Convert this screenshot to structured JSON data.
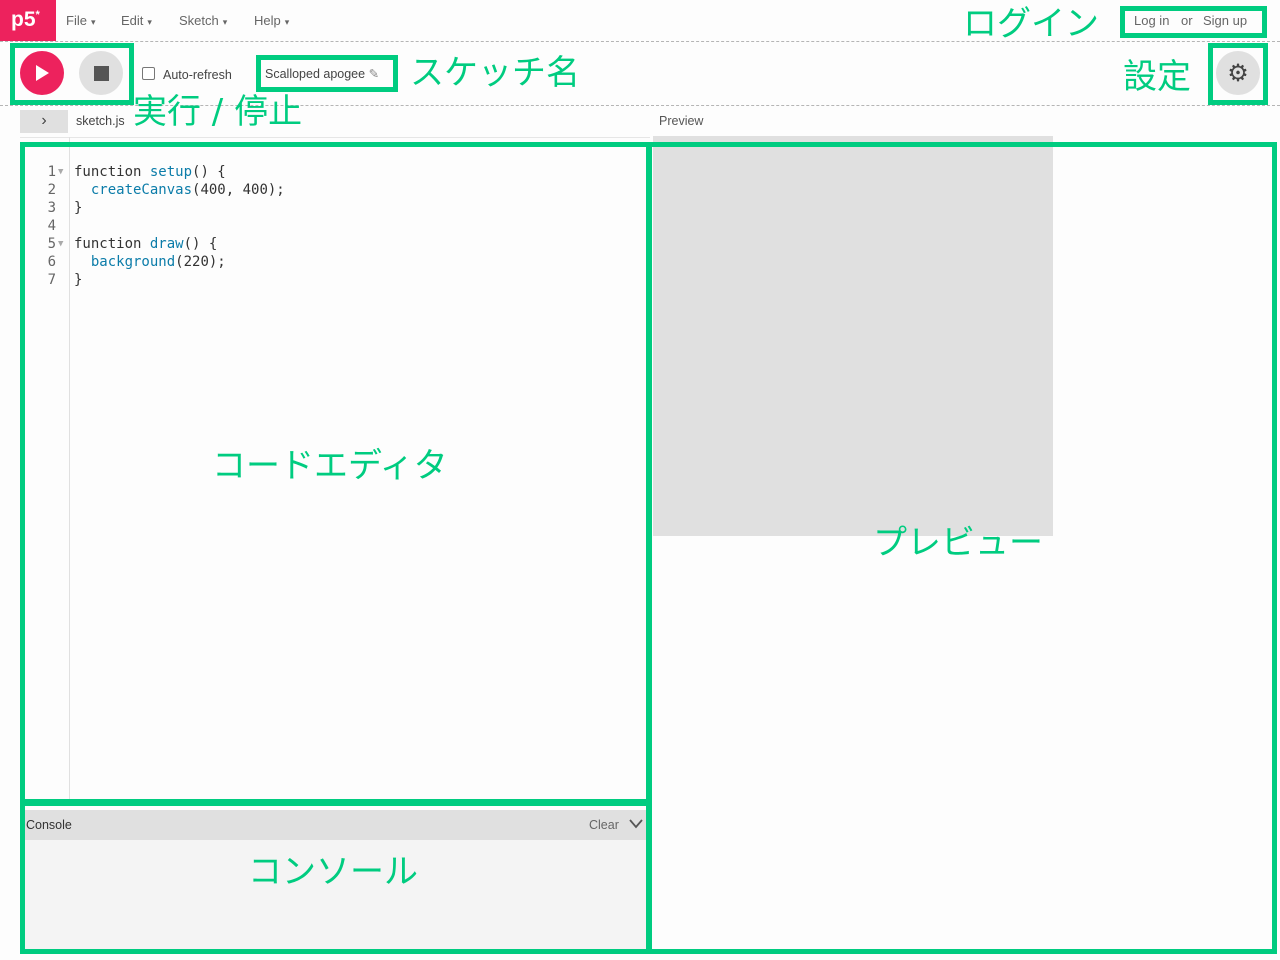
{
  "nav": {
    "logo": "p5",
    "logo_mark": "*",
    "menus": [
      "File",
      "Edit",
      "Sketch",
      "Help"
    ],
    "caret": "▾",
    "login": "Log in",
    "or": "or",
    "signup": "Sign up"
  },
  "toolbar": {
    "play_icon": "play-icon",
    "stop_icon": "stop-icon",
    "auto_refresh_label": "Auto-refresh",
    "auto_refresh_checked": false,
    "sketch_name": "Scalloped apogee",
    "edit_icon": "✎",
    "settings_icon": "⚙"
  },
  "tabs": {
    "toggle": "›",
    "file": "sketch.js",
    "preview": "Preview"
  },
  "editor": {
    "line_numbers": [
      "1",
      "2",
      "3",
      "4",
      "5",
      "6",
      "7"
    ],
    "lines": [
      [
        "function ",
        "setup",
        "() {"
      ],
      [
        "  ",
        "createCanvas",
        "(400, 400);"
      ],
      [
        "}",
        "",
        ""
      ],
      [
        "",
        "",
        ""
      ],
      [
        "function ",
        "draw",
        "() {"
      ],
      [
        "  ",
        "background",
        "(220);"
      ],
      [
        "}",
        "",
        ""
      ]
    ]
  },
  "console": {
    "title": "Console",
    "clear": "Clear",
    "chevron": "chevron-down-icon"
  },
  "annotations": {
    "login": "ログイン",
    "sketch_name": "スケッチ名",
    "run_stop": "実行 / 停止",
    "settings": "設定",
    "editor": "コードエディタ",
    "preview": "プレビュー",
    "console": "コンソール"
  },
  "colors": {
    "brand": "#ed225d",
    "annotation": "#00cc80",
    "canvas": "#dcdcdc"
  }
}
